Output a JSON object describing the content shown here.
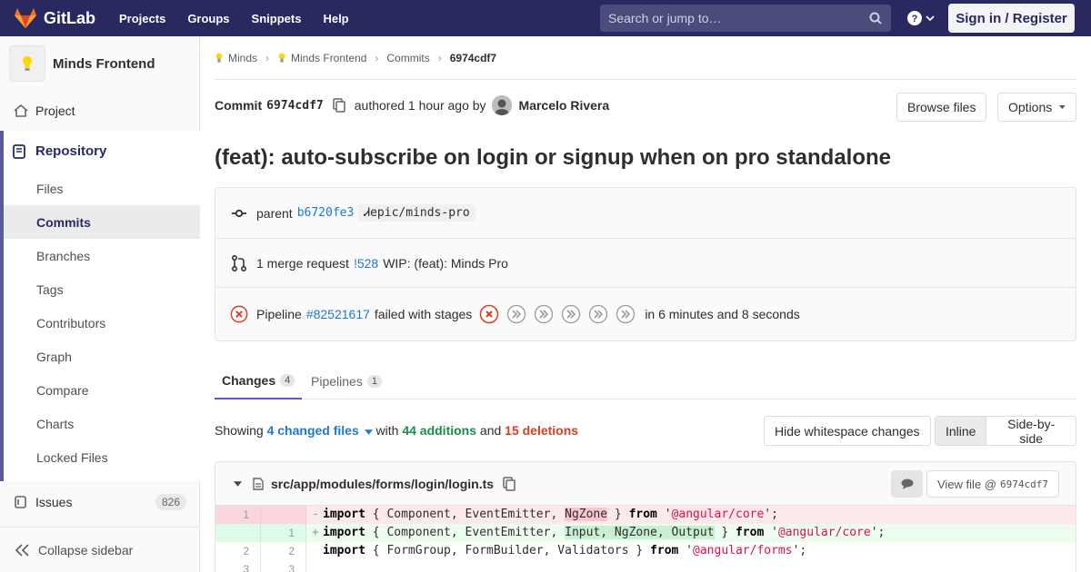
{
  "nav": {
    "brand": "GitLab",
    "links": [
      "Projects",
      "Groups",
      "Snippets",
      "Help"
    ],
    "search_placeholder": "Search or jump to…",
    "signin_label": "Sign in / Register"
  },
  "sidebar": {
    "project_name": "Minds Frontend",
    "project_label": "Project",
    "repository_label": "Repository",
    "repo_items": [
      "Files",
      "Commits",
      "Branches",
      "Tags",
      "Contributors",
      "Graph",
      "Compare",
      "Charts",
      "Locked Files"
    ],
    "active_item": "Commits",
    "issues_label": "Issues",
    "issues_count": "826",
    "collapse_label": "Collapse sidebar"
  },
  "breadcrumb": [
    "Minds",
    "Minds Frontend",
    "Commits",
    "6974cdf7"
  ],
  "commit": {
    "label": "Commit",
    "sha": "6974cdf7",
    "authored": "authored 1 hour ago by",
    "author": "Marcelo Rivera",
    "browse_label": "Browse files",
    "options_label": "Options",
    "title": "(feat): auto-subscribe on login or signup when on pro standalone"
  },
  "info": {
    "parent_label": "parent",
    "parent_sha": "b6720fe3",
    "branch": "epic/minds-pro",
    "mr_text": "1 merge request",
    "mr_id": "!528",
    "mr_title": "WIP: (feat): Minds Pro",
    "pipeline_label": "Pipeline",
    "pipeline_id": "#82521617",
    "pipeline_status": "failed with stages",
    "pipeline_duration": "in 6 minutes and 8 seconds"
  },
  "tabs": {
    "changes_label": "Changes",
    "changes_count": "4",
    "pipelines_label": "Pipelines",
    "pipelines_count": "1"
  },
  "diff_summary": {
    "showing": "Showing",
    "files": "4 changed files",
    "with": "with",
    "additions": "44 additions",
    "and": "and",
    "deletions": "15 deletions",
    "whitespace_label": "Hide whitespace changes",
    "inline_label": "Inline",
    "side_label": "Side-by-side"
  },
  "file": {
    "path": "src/app/modules/forms/login/login.ts",
    "view_label": "View file @",
    "view_sha": "6974cdf7",
    "lines": [
      {
        "old": "1",
        "new": "",
        "type": "old",
        "mark": "-",
        "code": "import { Component, EventEmitter, NgZone } from '@angular/core';"
      },
      {
        "old": "",
        "new": "1",
        "type": "new",
        "mark": "+",
        "code": "import { Component, EventEmitter, Input, NgZone, Output } from '@angular/core';"
      },
      {
        "old": "2",
        "new": "2",
        "type": "ctx",
        "mark": "",
        "code": "import { FormGroup, FormBuilder, Validators } from '@angular/forms';"
      },
      {
        "old": "3",
        "new": "3",
        "type": "ctx",
        "mark": "",
        "code": ""
      }
    ]
  },
  "colors": {
    "navbar": "#292961",
    "link": "#1f78d1",
    "additions": "#168f48",
    "deletions": "#db3b21"
  }
}
